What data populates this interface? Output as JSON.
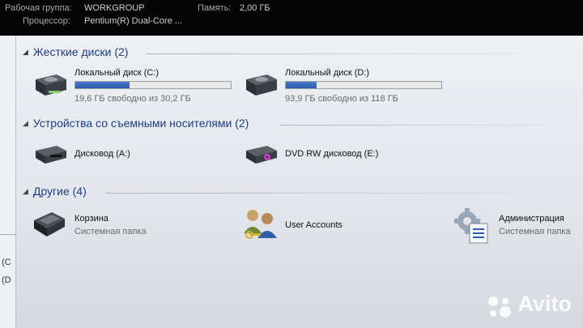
{
  "info": {
    "workgroup_label": "Рабочая группа:",
    "workgroup_value": "WORKGROUP",
    "memory_label": "Память:",
    "memory_value": "2,00 ГБ",
    "cpu_label": "Процессор:",
    "cpu_value": "Pentium(R) Dual-Core ..."
  },
  "left_pane": {
    "fragments": [
      "(C",
      "(D"
    ]
  },
  "groups": {
    "hard_drives": {
      "title": "Жесткие диски (2)",
      "items": [
        {
          "name": "Локальный диск (C:)",
          "free": "19,6 ГБ свободно из 30,2 ГБ",
          "used_fraction": 0.35
        },
        {
          "name": "Локальный диск (D:)",
          "free": "93,9 ГБ свободно из 118 ГБ",
          "used_fraction": 0.2
        }
      ]
    },
    "removable": {
      "title": "Устройства со съемными носителями (2)",
      "items": [
        {
          "name": "Дисковод (A:)"
        },
        {
          "name": "DVD RW дисковод (E:)"
        }
      ]
    },
    "other": {
      "title": "Другие (4)",
      "items": [
        {
          "name": "Корзина",
          "sub": "Системная папка"
        },
        {
          "name": "User Accounts"
        },
        {
          "name": "Администрация",
          "sub": "Системная папка"
        }
      ]
    }
  },
  "watermark": {
    "text": "Avito"
  },
  "colors": {
    "header": "#1d3d8a",
    "bar_fill": "#2b57a8",
    "background": "#e2e5ea"
  }
}
